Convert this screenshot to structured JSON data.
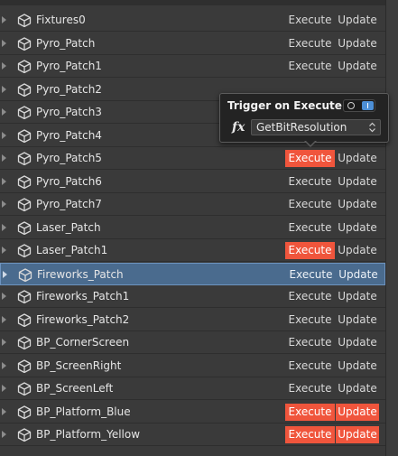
{
  "rows": [
    {
      "name": "Fixtures0",
      "execute_label": "Execute",
      "update_label": "Update",
      "execute_active": false,
      "update_active": false,
      "selected": false
    },
    {
      "name": "Pyro_Patch",
      "execute_label": "Execute",
      "update_label": "Update",
      "execute_active": false,
      "update_active": false,
      "selected": false
    },
    {
      "name": "Pyro_Patch1",
      "execute_label": "Execute",
      "update_label": "Update",
      "execute_active": false,
      "update_active": false,
      "selected": false
    },
    {
      "name": "Pyro_Patch2",
      "execute_label": "",
      "update_label": "",
      "execute_active": false,
      "update_active": false,
      "selected": false
    },
    {
      "name": "Pyro_Patch3",
      "execute_label": "",
      "update_label": "",
      "execute_active": false,
      "update_active": false,
      "selected": false
    },
    {
      "name": "Pyro_Patch4",
      "execute_label": "",
      "update_label": "",
      "execute_active": false,
      "update_active": false,
      "selected": false
    },
    {
      "name": "Pyro_Patch5",
      "execute_label": "Execute",
      "update_label": "Update",
      "execute_active": true,
      "update_active": false,
      "selected": false
    },
    {
      "name": "Pyro_Patch6",
      "execute_label": "Execute",
      "update_label": "Update",
      "execute_active": false,
      "update_active": false,
      "selected": false
    },
    {
      "name": "Pyro_Patch7",
      "execute_label": "Execute",
      "update_label": "Update",
      "execute_active": false,
      "update_active": false,
      "selected": false
    },
    {
      "name": "Laser_Patch",
      "execute_label": "Execute",
      "update_label": "Update",
      "execute_active": false,
      "update_active": false,
      "selected": false
    },
    {
      "name": "Laser_Patch1",
      "execute_label": "Execute",
      "update_label": "Update",
      "execute_active": true,
      "update_active": false,
      "selected": false
    },
    {
      "name": "Fireworks_Patch",
      "execute_label": "Execute",
      "update_label": "Update",
      "execute_active": false,
      "update_active": false,
      "selected": true
    },
    {
      "name": "Fireworks_Patch1",
      "execute_label": "Execute",
      "update_label": "Update",
      "execute_active": false,
      "update_active": false,
      "selected": false
    },
    {
      "name": "Fireworks_Patch2",
      "execute_label": "Execute",
      "update_label": "Update",
      "execute_active": false,
      "update_active": false,
      "selected": false
    },
    {
      "name": "BP_CornerScreen",
      "execute_label": "Execute",
      "update_label": "Update",
      "execute_active": false,
      "update_active": false,
      "selected": false
    },
    {
      "name": "BP_ScreenRight",
      "execute_label": "Execute",
      "update_label": "Update",
      "execute_active": false,
      "update_active": false,
      "selected": false
    },
    {
      "name": "BP_ScreenLeft",
      "execute_label": "Execute",
      "update_label": "Update",
      "execute_active": false,
      "update_active": false,
      "selected": false
    },
    {
      "name": "BP_Platform_Blue",
      "execute_label": "Execute",
      "update_label": "Update",
      "execute_active": true,
      "update_active": true,
      "selected": false
    },
    {
      "name": "BP_Platform_Yellow",
      "execute_label": "Execute",
      "update_label": "Update",
      "execute_active": true,
      "update_active": true,
      "selected": false
    }
  ],
  "popover": {
    "title": "Trigger on Execute",
    "toggle_on": true,
    "fx_symbol": "fx",
    "function_value": "GetBitResolution"
  },
  "colors": {
    "active_red": "#f0553c",
    "selected_row": "#4a6b8e",
    "toggle_blue": "#4d8fd6"
  },
  "icons": {
    "row_icon": "cube-icon",
    "expander": "triangle-right-icon",
    "select_arrows": "up-down-arrows-icon"
  }
}
